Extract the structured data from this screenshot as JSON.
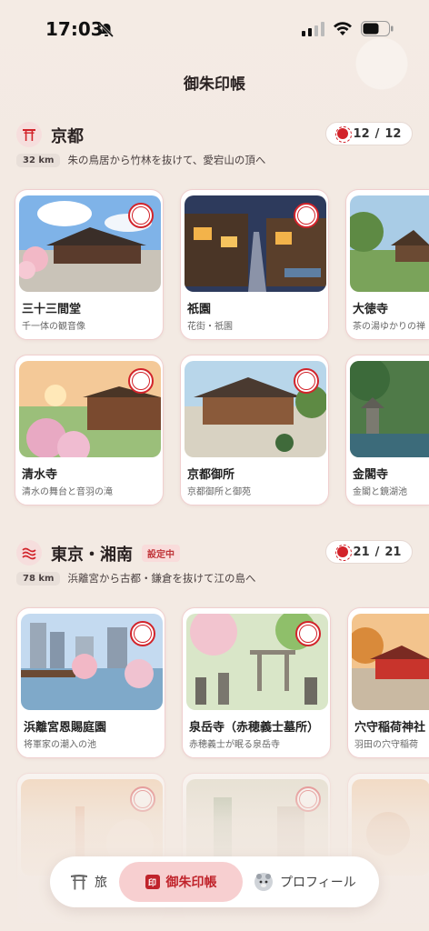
{
  "status_bar": {
    "time": "17:03"
  },
  "header": {
    "title": "御朱印帳"
  },
  "sections": [
    {
      "title": "京都",
      "badge": "",
      "distance": "32 km",
      "route": "朱の鳥居から竹林を抜けて、愛宕山の頂へ",
      "collected": "12",
      "separator": "/",
      "total": "12",
      "cards": [
        {
          "name": "三十三間堂",
          "desc": "千一体の観音像"
        },
        {
          "name": "祇園",
          "desc": "花街・祇園"
        },
        {
          "name": "大徳寺",
          "desc": "茶の湯ゆかりの禅"
        },
        {
          "name": "清水寺",
          "desc": "清水の舞台と音羽の滝"
        },
        {
          "name": "京都御所",
          "desc": "京都御所と御苑"
        },
        {
          "name": "金閣寺",
          "desc": "金閣と鏡湖池"
        }
      ]
    },
    {
      "title": "東京・湘南",
      "badge": "設定中",
      "distance": "78 km",
      "route": "浜離宮から古都・鎌倉を抜けて江の島へ",
      "collected": "21",
      "separator": "/",
      "total": "21",
      "cards": [
        {
          "name": "浜離宮恩賜庭園",
          "desc": "将軍家の潮入の池"
        },
        {
          "name": "泉岳寺（赤穂義士墓所）",
          "desc": "赤穂義士が眠る泉岳寺"
        },
        {
          "name": "穴守稲荷神社",
          "desc": "羽田の穴守稲荷"
        }
      ]
    }
  ],
  "tab_bar": {
    "tabs": [
      {
        "label": "旅",
        "icon": "torii-icon"
      },
      {
        "label": "御朱印帳",
        "icon": "seal-icon",
        "icon_text": "印"
      },
      {
        "label": "プロフィール",
        "icon": "avatar-icon"
      }
    ]
  },
  "colors": {
    "accent": "#d2232a",
    "background": "#f3eae3",
    "active_tab": "#f7cfd0"
  }
}
